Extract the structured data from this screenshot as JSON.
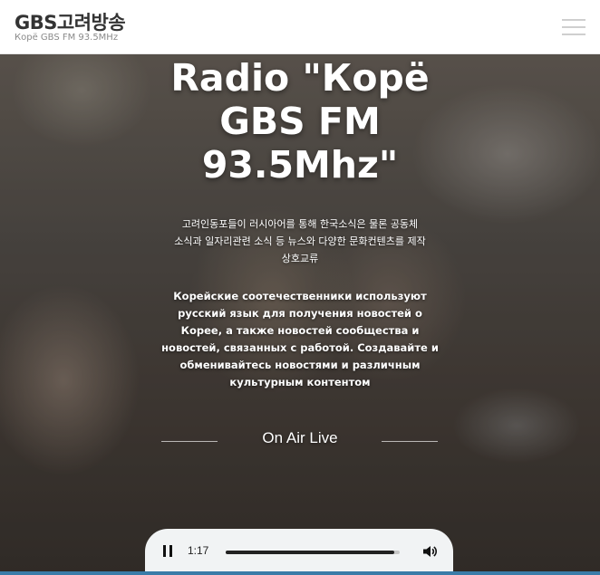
{
  "header": {
    "logo_title": "GBS고려방송",
    "logo_subtitle": "Корё GBS FM 93.5MHz",
    "menu_icon": "hamburger-menu-icon"
  },
  "hero": {
    "title_line1": "Radio \"Корё",
    "title_line2": "GBS FM",
    "title_line3": "93.5Mhz\"",
    "description_ko_line1": "고려인동포들이 러시아어를 통해 한국소식은 물론 공동체",
    "description_ko_line2": "소식과 일자리관련 소식 등 뉴스와 다양한 문화컨텐츠를 제작",
    "description_ko_line3": "상호교류",
    "description_ru_line1": "Корейские соотечественники используют",
    "description_ru_line2": "русский язык для получения новостей о",
    "description_ru_line3": "Корее, а также новостей сообщества и",
    "description_ru_line4": "новостей, связанных с работой. Создавайте и",
    "description_ru_line5": "обменивайтесь новостями и различным",
    "description_ru_line6": "культурным контентом",
    "on_air_label": "On Air Live"
  },
  "player": {
    "time": "1:17",
    "progress": 0.97,
    "pause_icon": "pause-icon",
    "volume_icon": "volume-icon"
  },
  "colors": {
    "header_bg": "#ffffff",
    "logo_text": "#333333",
    "accent_strip": "#3a7ca8"
  }
}
